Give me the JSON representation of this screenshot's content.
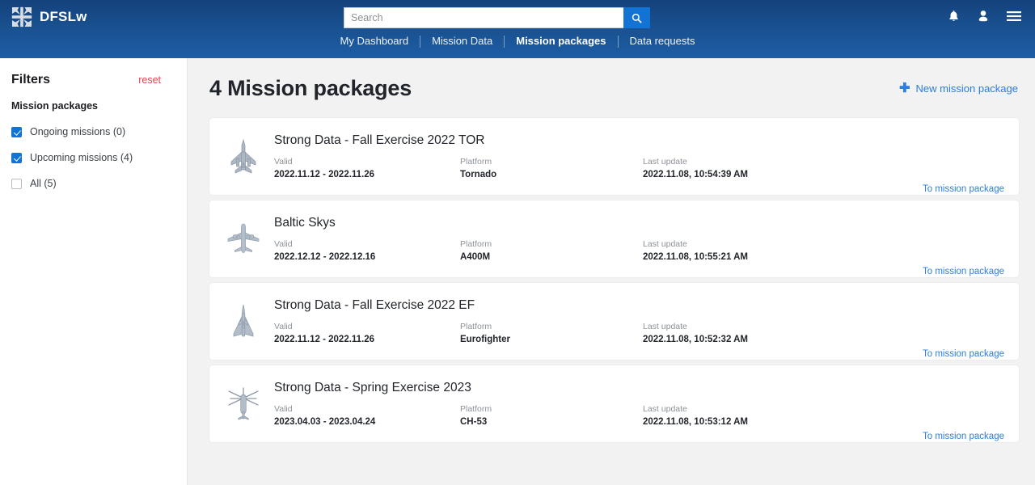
{
  "header": {
    "brand": "DFSLw",
    "logo_icon": "iron-cross-logo",
    "search": {
      "value": "",
      "placeholder": "Search",
      "button_icon": "search-icon"
    },
    "nav": [
      {
        "label": "My Dashboard",
        "active": false
      },
      {
        "label": "Mission Data",
        "active": false
      },
      {
        "label": "Mission packages",
        "active": true
      },
      {
        "label": "Data requests",
        "active": false
      }
    ],
    "icons": [
      {
        "name": "notifications-bell-icon"
      },
      {
        "name": "user-account-icon"
      },
      {
        "name": "hamburger-menu-icon"
      }
    ]
  },
  "sidebar": {
    "title": "Filters",
    "reset_label": "reset",
    "group_label": "Mission packages",
    "filters": [
      {
        "label": "Ongoing missions (0)",
        "checked": true
      },
      {
        "label": "Upcoming missions (4)",
        "checked": true
      },
      {
        "label": "All (5)",
        "checked": false
      }
    ]
  },
  "main": {
    "page_title": "4 Mission packages",
    "new_button_label": "New mission package",
    "new_button_icon": "plus-icon",
    "labels": {
      "valid": "Valid",
      "platform": "Platform",
      "last_update": "Last update"
    },
    "link_label": "To mission package",
    "packages": [
      {
        "title": "Strong Data - Fall Exercise 2022 TOR",
        "valid": "2022.11.12 - 2022.11.26",
        "platform": "Tornado",
        "last_update": "2022.11.08, 10:54:39 AM",
        "icon": "tornado-jet-icon"
      },
      {
        "title": "Baltic Skys",
        "valid": "2022.12.12 - 2022.12.16",
        "platform": "A400M",
        "last_update": "2022.11.08, 10:55:21 AM",
        "icon": "a400m-transport-aircraft-icon"
      },
      {
        "title": "Strong Data - Fall Exercise 2022 EF",
        "valid": "2022.11.12 - 2022.11.26",
        "platform": "Eurofighter",
        "last_update": "2022.11.08, 10:52:32 AM",
        "icon": "eurofighter-jet-icon"
      },
      {
        "title": "Strong Data - Spring Exercise 2023",
        "valid": "2023.04.03 - 2023.04.24",
        "platform": "CH-53",
        "last_update": "2022.11.08, 10:53:12 AM",
        "icon": "ch53-helicopter-icon"
      }
    ]
  },
  "colors": {
    "header_top": "#14427c",
    "header_bottom": "#1d5da5",
    "accent_blue": "#1273d4",
    "link_blue": "#2b7de0",
    "reset_red": "#e8414f",
    "content_bg": "#f2f2f2"
  }
}
